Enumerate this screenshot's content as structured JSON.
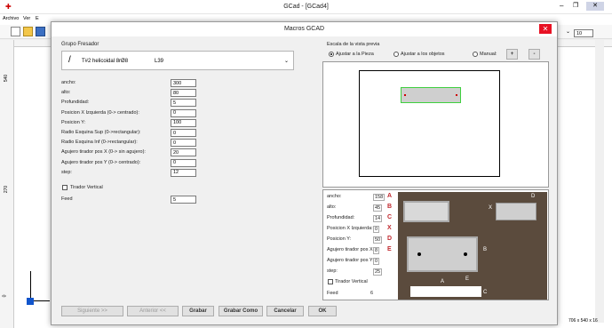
{
  "app": {
    "title": "GCad - [GCad4]",
    "menu": [
      "Archivo",
      "Ver",
      "E"
    ],
    "zoom_value": "10",
    "status_dims": "706 x 540 x 16",
    "ruler_v_labels": [
      "540",
      "270",
      "0"
    ]
  },
  "dialog": {
    "title": "Macros GCAD",
    "close": "✕",
    "group_label": "Grupo Fresador",
    "tool_icon": "/",
    "tool_value": "T#2 helicoidal 8rØ8",
    "tool_len": "L39",
    "params": [
      {
        "label": "ancho:",
        "value": "300"
      },
      {
        "label": "alto:",
        "value": "80"
      },
      {
        "label": "Profundidad:",
        "value": "5"
      },
      {
        "label": "Posicion X Izquierda (0-> centrado):",
        "value": "0"
      },
      {
        "label": "Posicion Y:",
        "value": "100"
      },
      {
        "label": "Radio Esquina Sup (0->rectangular):",
        "value": "0"
      },
      {
        "label": "Radio Esquina Inf (0->rectangular):",
        "value": "0"
      },
      {
        "label": "Agujero tirador pos X (0-> sin agujero):",
        "value": "20"
      },
      {
        "label": "Agujero tirador pos Y (0-> centrado):",
        "value": "0"
      },
      {
        "label": "step:",
        "value": "12"
      }
    ],
    "tirador_label": "Tirador Vertical",
    "feed_label": "Feed",
    "feed_value": "5",
    "scale": {
      "label": "Escala de la vista previa",
      "options": [
        "Ajustar a la Pieza",
        "Ajustar a los objetos",
        "Manual:"
      ],
      "selected": 0,
      "plus": "+",
      "minus": "-"
    },
    "ref_params": [
      {
        "label": "ancho:",
        "value": "158",
        "letter": "A"
      },
      {
        "label": "alto:",
        "value": "45",
        "letter": "B"
      },
      {
        "label": "Profundidad:",
        "value": "14",
        "letter": "C"
      },
      {
        "label": "Posicion X Izquierda:",
        "value": "0",
        "letter": "X"
      },
      {
        "label": "Posicion Y:",
        "value": "50",
        "letter": "D"
      },
      {
        "label": "Agujero tirador pos X:",
        "value": "8",
        "letter": "E"
      },
      {
        "label": "Agujero tirador pos Y:",
        "value": "0",
        "letter": ""
      },
      {
        "label": "step:",
        "value": "25",
        "letter": ""
      }
    ],
    "ref_tirador": "Tirador Vertical",
    "ref_feed_label": "Feed",
    "ref_feed_value": "6",
    "photo_letters": [
      "D",
      "X",
      "B",
      "E",
      "A",
      "C"
    ],
    "buttons": {
      "next": "Siguiente >>",
      "prev": "Anterior <<",
      "save": "Grabar",
      "save_as": "Grabar Como",
      "cancel": "Cancelar",
      "ok": "OK"
    }
  },
  "colors": {
    "preview_green": "#3fcf3f",
    "close_red": "#e81123",
    "letter_red": "#c0272d"
  }
}
